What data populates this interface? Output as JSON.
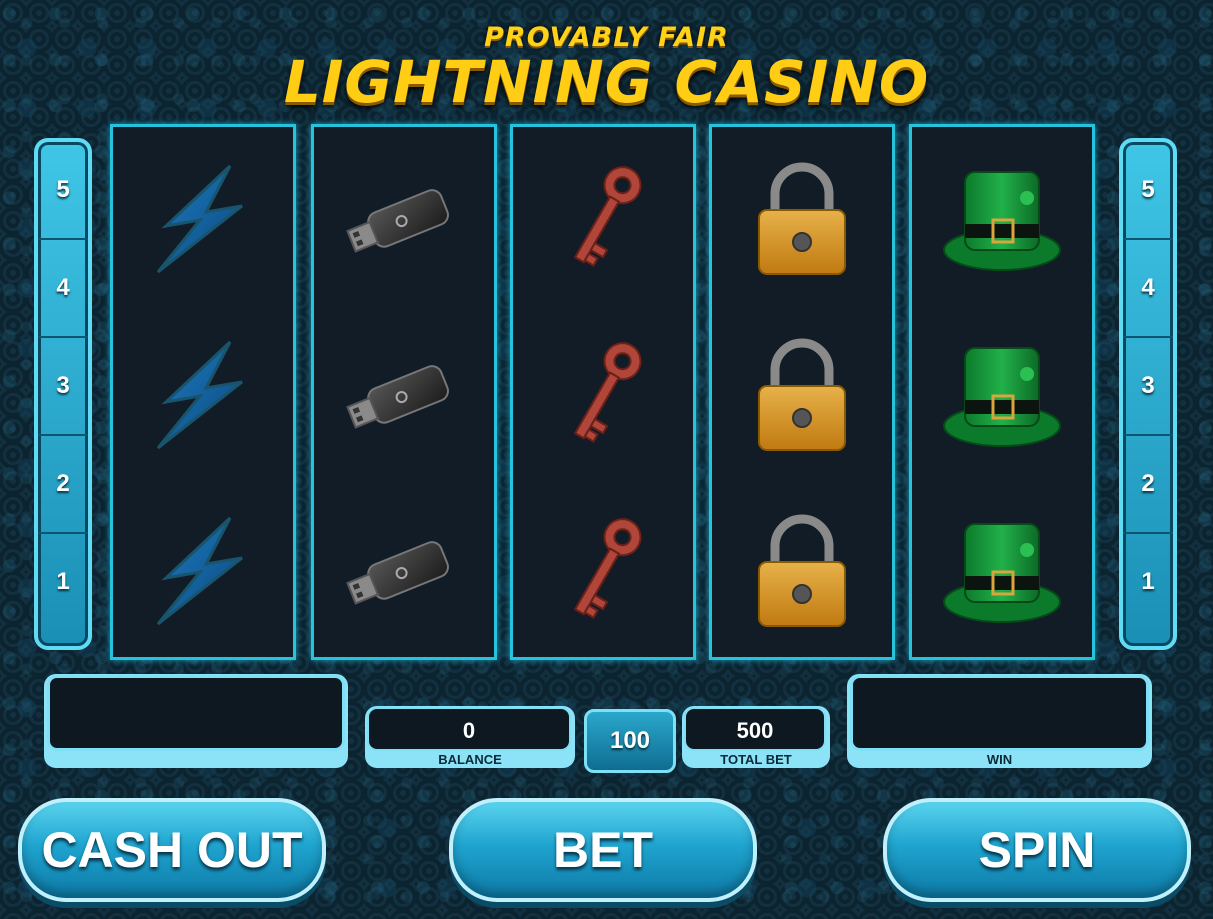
{
  "title": {
    "top": "PROVABLY FAIR",
    "main": "LIGHTNING CASINO"
  },
  "paylines": {
    "left": [
      "5",
      "4",
      "3",
      "2",
      "1"
    ],
    "right": [
      "5",
      "4",
      "3",
      "2",
      "1"
    ]
  },
  "reels": [
    {
      "symbol": "lightning-bolt",
      "rows": 3
    },
    {
      "symbol": "usb-drive",
      "rows": 3
    },
    {
      "symbol": "key",
      "rows": 3
    },
    {
      "symbol": "padlock",
      "rows": 3
    },
    {
      "symbol": "leprechaun-hat",
      "rows": 3
    }
  ],
  "meters": {
    "balance": {
      "value": "0",
      "label": "BALANCE"
    },
    "bet_amount": "100",
    "total_bet": {
      "value": "500",
      "label": "TOTAL BET"
    },
    "win": {
      "value": "",
      "label": "WIN"
    },
    "message": ""
  },
  "buttons": {
    "cash_out": "CASH OUT",
    "bet": "BET",
    "spin": "SPIN"
  },
  "colors": {
    "accent": "#27c3dd",
    "title": "#ffce14",
    "reel_bg": "#121c26"
  }
}
